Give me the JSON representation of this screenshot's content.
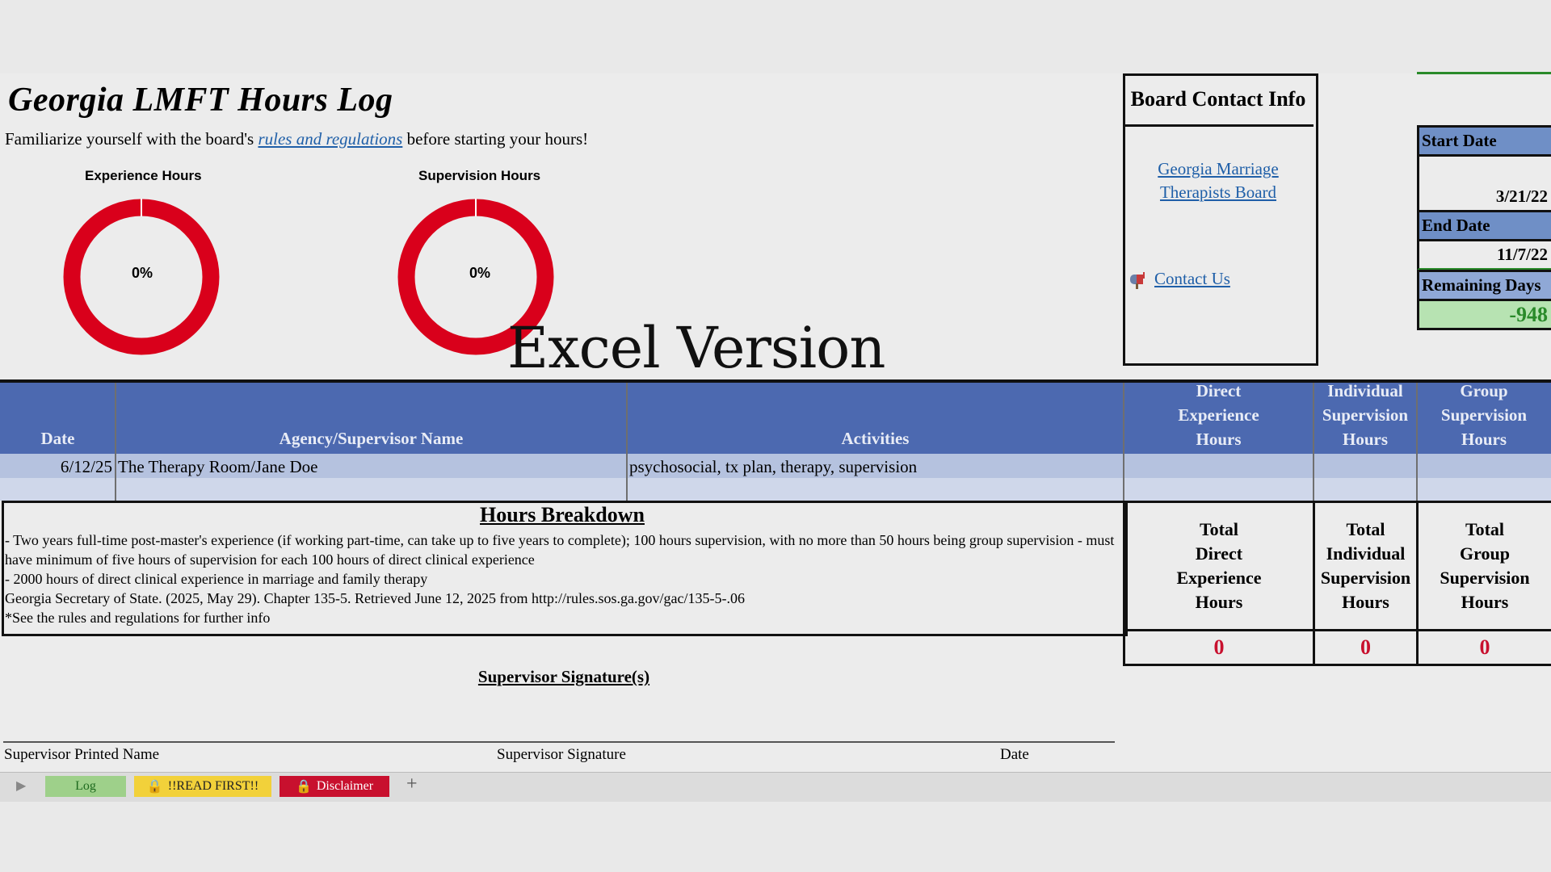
{
  "header": {
    "title": "Georgia LMFT Hours Log",
    "subtitle_before": "Familiarize yourself with the board's ",
    "subtitle_link": "rules and regulations",
    "subtitle_after": " before starting your hours!"
  },
  "donuts": [
    {
      "label": "Experience Hours",
      "percent_text": "0%",
      "progress": 0
    },
    {
      "label": "Supervision Hours",
      "percent_text": "0%",
      "progress": 0
    }
  ],
  "overlay_text": "Excel Version",
  "board": {
    "heading": "Board Contact Info",
    "link_line1": "Georgia Marriage",
    "link_line2": "Therapists Board",
    "contact": "Contact Us"
  },
  "dates": {
    "start_label": "Start Date",
    "start_value": "3/21/22",
    "end_label": "End Date",
    "end_value": "11/7/22",
    "remaining_label": "Remaining Days",
    "remaining_value": "-948"
  },
  "table": {
    "headers": {
      "date": "Date",
      "agency": "Agency/Supervisor Name",
      "activities": "Activities",
      "direct": [
        "Direct",
        "Experience",
        "Hours"
      ],
      "individual": [
        "Individual",
        "Supervision",
        "Hours"
      ],
      "group": [
        "Group",
        "Supervision",
        "Hours"
      ]
    },
    "rows": [
      {
        "date": "6/12/25",
        "agency": "The Therapy Room/Jane Doe",
        "activities": "psychosocial, tx plan, therapy, supervision"
      }
    ]
  },
  "breakdown": {
    "title": "Hours Breakdown",
    "lines": [
      "- Two years full-time post-master's experience (if working part-time, can take up to five years to complete); 100 hours supervision, with no more than 50 hours being group supervision - must have minimum of five hours of supervision for each 100 hours of direct clinical experience",
      "- 2000 hours of direct clinical experience in marriage and family therapy",
      "Georgia Secretary of State. (2025, May 29). Chapter 135-5. Retrieved June 12, 2025 from http://rules.sos.ga.gov/gac/135-5-.06",
      "*See the rules and regulations for further info"
    ]
  },
  "totals": {
    "direct_label": [
      "Total",
      "Direct",
      "Experience",
      "Hours"
    ],
    "individual_label": [
      "Total",
      "Individual",
      "Supervision",
      "Hours"
    ],
    "group_label": [
      "Total",
      "Group",
      "Supervision",
      "Hours"
    ],
    "direct_value": "0",
    "individual_value": "0",
    "group_value": "0"
  },
  "signature": {
    "title": "Supervisor Signature(s)",
    "printed_name": "Supervisor Printed Name",
    "signature": "Supervisor Signature",
    "date": "Date"
  },
  "tabs": [
    {
      "label": "Log",
      "color": "#9ed08a"
    },
    {
      "label": "!!READ FIRST!!",
      "color": "#f2d13a"
    },
    {
      "label": "Disclaimer",
      "color": "#c8102e"
    }
  ],
  "colors": {
    "header_blue": "#4c69b0",
    "donut_red": "#d9001b",
    "total_red": "#c8102e",
    "remaining_green": "#b7e3b2"
  }
}
